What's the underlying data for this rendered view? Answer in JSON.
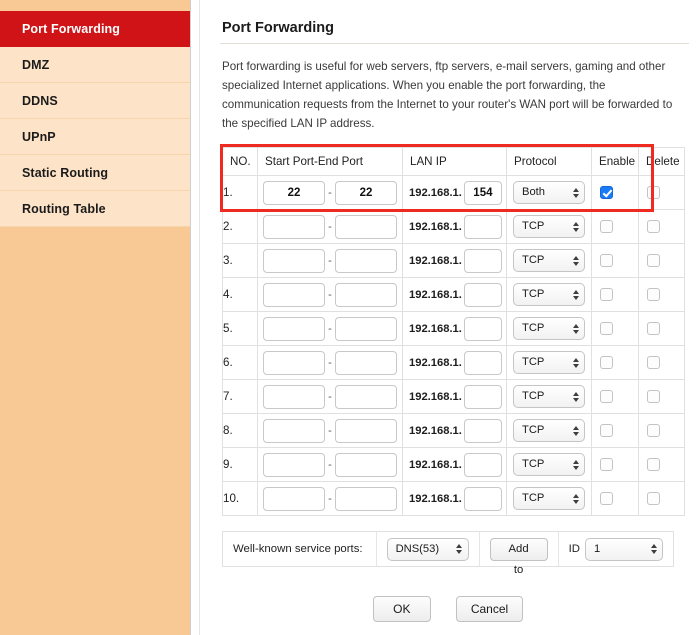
{
  "sidebar": {
    "items": [
      {
        "label": "Port Forwarding",
        "active": true
      },
      {
        "label": "DMZ",
        "active": false
      },
      {
        "label": "DDNS",
        "active": false
      },
      {
        "label": "UPnP",
        "active": false
      },
      {
        "label": "Static Routing",
        "active": false
      },
      {
        "label": "Routing Table",
        "active": false
      }
    ]
  },
  "page": {
    "title": "Port Forwarding",
    "intro": "Port forwarding is useful for web servers, ftp servers, e-mail servers, gaming and other specialized Internet applications. When you enable the port forwarding, the communication requests from the Internet to your router's WAN port will be forwarded to the specified LAN IP address."
  },
  "table": {
    "headers": {
      "no": "NO.",
      "ports": "Start Port-End Port",
      "lanip": "LAN IP",
      "protocol": "Protocol",
      "enable": "Enable",
      "delete": "Delete"
    },
    "dash": "-",
    "lan_prefix": "192.168.1.",
    "rows": [
      {
        "no": "1.",
        "start_port": "22",
        "end_port": "22",
        "lan_host": "154",
        "protocol": "Both",
        "enabled": true,
        "delete": false
      },
      {
        "no": "2.",
        "start_port": "",
        "end_port": "",
        "lan_host": "",
        "protocol": "TCP",
        "enabled": false,
        "delete": false
      },
      {
        "no": "3.",
        "start_port": "",
        "end_port": "",
        "lan_host": "",
        "protocol": "TCP",
        "enabled": false,
        "delete": false
      },
      {
        "no": "4.",
        "start_port": "",
        "end_port": "",
        "lan_host": "",
        "protocol": "TCP",
        "enabled": false,
        "delete": false
      },
      {
        "no": "5.",
        "start_port": "",
        "end_port": "",
        "lan_host": "",
        "protocol": "TCP",
        "enabled": false,
        "delete": false
      },
      {
        "no": "6.",
        "start_port": "",
        "end_port": "",
        "lan_host": "",
        "protocol": "TCP",
        "enabled": false,
        "delete": false
      },
      {
        "no": "7.",
        "start_port": "",
        "end_port": "",
        "lan_host": "",
        "protocol": "TCP",
        "enabled": false,
        "delete": false
      },
      {
        "no": "8.",
        "start_port": "",
        "end_port": "",
        "lan_host": "",
        "protocol": "TCP",
        "enabled": false,
        "delete": false
      },
      {
        "no": "9.",
        "start_port": "",
        "end_port": "",
        "lan_host": "",
        "protocol": "TCP",
        "enabled": false,
        "delete": false
      },
      {
        "no": "10.",
        "start_port": "",
        "end_port": "",
        "lan_host": "",
        "protocol": "TCP",
        "enabled": false,
        "delete": false
      }
    ]
  },
  "service_bar": {
    "label": "Well-known service ports:",
    "service_selected": "DNS(53)",
    "add_button": "Add to",
    "id_label": "ID",
    "id_selected": "1"
  },
  "actions": {
    "ok": "OK",
    "cancel": "Cancel"
  },
  "colors": {
    "sidebar_bg": "#f8c994",
    "sidebar_item_bg": "#fde4c8",
    "active_item_bg": "#cf1317",
    "highlight_border": "#ef2a20",
    "checkbox_checked": "#1a7cf9"
  }
}
